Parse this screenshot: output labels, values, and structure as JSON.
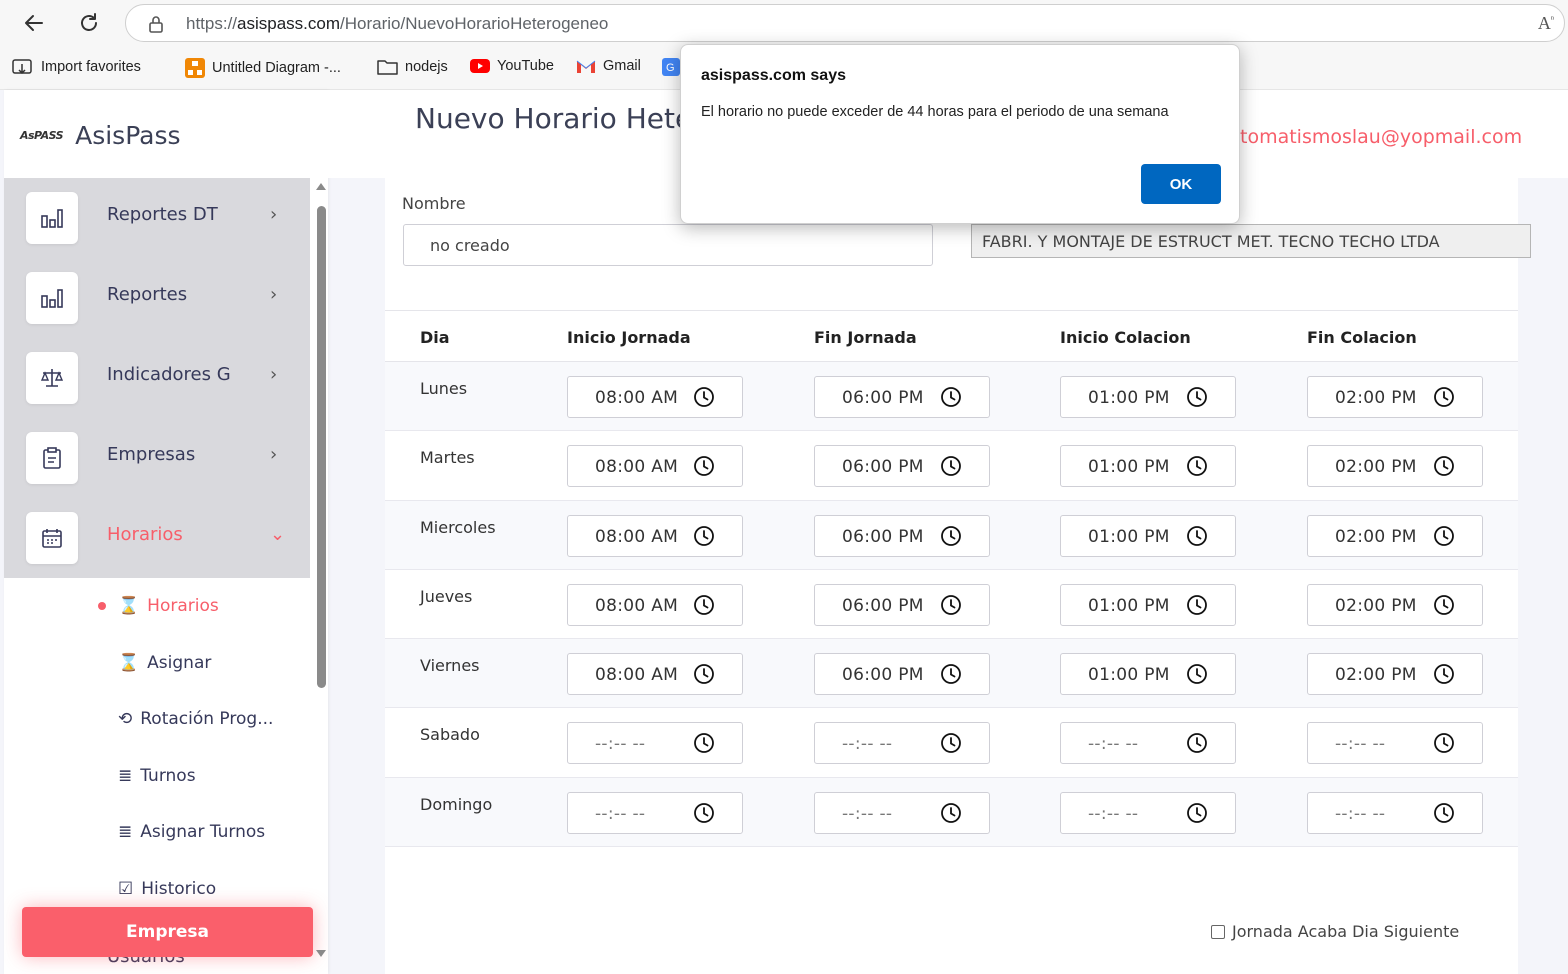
{
  "browser": {
    "url_prefix": "https://",
    "url_host": "asispass.com",
    "url_path": "/Horario/NuevoHorarioHeterogeneo",
    "bookmarks": [
      {
        "label": "Import favorites",
        "icon": "import-icon"
      },
      {
        "label": "Untitled Diagram -...",
        "icon": "drawio-icon"
      },
      {
        "label": "nodejs",
        "icon": "folder-icon"
      },
      {
        "label": "YouTube",
        "icon": "youtube-icon"
      },
      {
        "label": "Gmail",
        "icon": "gmail-icon"
      }
    ]
  },
  "sidebar": {
    "brand_logo": "AsPASS",
    "brand_name": "AsisPass",
    "menu": [
      {
        "label": "Reportes DT",
        "icon": "bar-chart-icon",
        "chevron": "›"
      },
      {
        "label": "Reportes",
        "icon": "bar-chart-icon",
        "chevron": "›"
      },
      {
        "label": "Indicadores G",
        "icon": "scale-icon",
        "chevron": "›"
      },
      {
        "label": "Empresas",
        "icon": "clipboard-icon",
        "chevron": "›"
      },
      {
        "label": "Horarios",
        "icon": "calendar-icon",
        "chevron": "⌄",
        "active": true
      }
    ],
    "submenu": [
      {
        "label": "Horarios",
        "icon": "hourglass-icon",
        "active": true
      },
      {
        "label": "Asignar",
        "icon": "hourglass-icon"
      },
      {
        "label": "Rotación Prog...",
        "icon": "repeat-icon"
      },
      {
        "label": "Turnos",
        "icon": "lines-icon"
      },
      {
        "label": "Asignar Turnos",
        "icon": "lines-icon"
      },
      {
        "label": "Historico",
        "icon": "calendar-check-icon"
      }
    ],
    "empresa_button": "Empresa",
    "hidden_item": "Usuarios"
  },
  "header": {
    "title": "Nuevo Horario Hete",
    "user_email": "tomatismoslau@yopmail.com"
  },
  "form": {
    "nombre_label": "Nombre",
    "nombre_value": "no creado",
    "empresa_value": "FABRI. Y MONTAJE DE ESTRUCT MET. TECNO TECHO LTDA",
    "checkbox_label": "Jornada Acaba Dia Siguiente"
  },
  "table": {
    "headers": [
      "Dia",
      "Inicio Jornada",
      "Fin Jornada",
      "Inicio Colacion",
      "Fin Colacion"
    ],
    "rows": [
      {
        "day": "Lunes",
        "times": [
          "08:00 AM",
          "06:00 PM",
          "01:00 PM",
          "02:00 PM"
        ]
      },
      {
        "day": "Martes",
        "times": [
          "08:00 AM",
          "06:00 PM",
          "01:00 PM",
          "02:00 PM"
        ]
      },
      {
        "day": "Miercoles",
        "times": [
          "08:00 AM",
          "06:00 PM",
          "01:00 PM",
          "02:00 PM"
        ]
      },
      {
        "day": "Jueves",
        "times": [
          "08:00 AM",
          "06:00 PM",
          "01:00 PM",
          "02:00 PM"
        ]
      },
      {
        "day": "Viernes",
        "times": [
          "08:00 AM",
          "06:00 PM",
          "01:00 PM",
          "02:00 PM"
        ]
      },
      {
        "day": "Sabado",
        "times": [
          "--:-- --",
          "--:-- --",
          "--:-- --",
          "--:-- --"
        ]
      },
      {
        "day": "Domingo",
        "times": [
          "--:-- --",
          "--:-- --",
          "--:-- --",
          "--:-- --"
        ]
      }
    ]
  },
  "dialog": {
    "title": "asispass.com says",
    "message": "El horario no puede exceder de 44 horas para el periodo de una semana",
    "ok_label": "OK"
  },
  "colors": {
    "accent": "#f75e6a",
    "ok_button": "#0067c0",
    "menu_bg": "#d9d9dd"
  }
}
